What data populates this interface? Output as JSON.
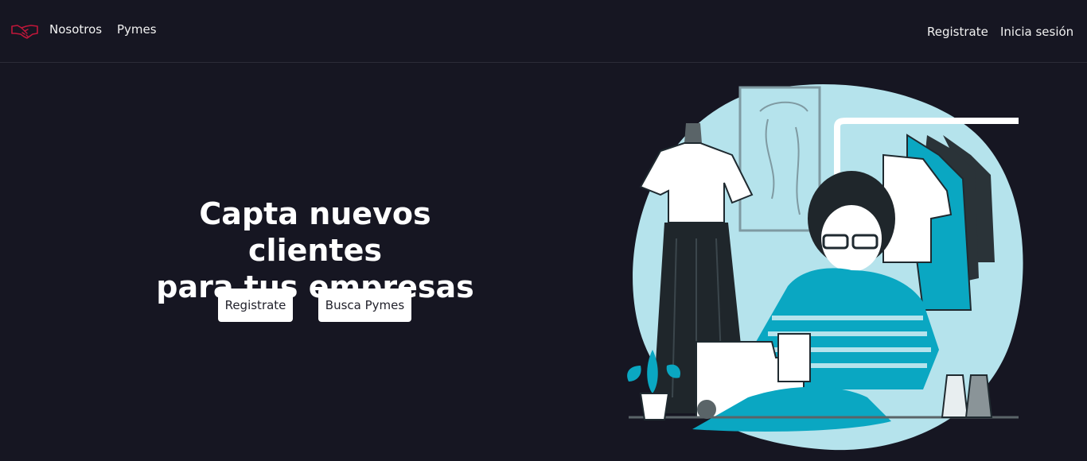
{
  "nav": {
    "logo_icon": "handshake-icon",
    "links": [
      "Nosotros",
      "Pymes"
    ],
    "right_links": [
      "Registrate",
      "Inicia sesión"
    ]
  },
  "hero": {
    "title_line1": "Capta nuevos clientes",
    "title_line2": "para tus empresas",
    "buttons": [
      "Registrate",
      "Busca Pymes"
    ],
    "illustration": "tailor-sewing-illustration"
  },
  "colors": {
    "background": "#161622",
    "accent_teal": "#0aa7c2",
    "blob_light": "#b5e3ec",
    "logo_red": "#c0173a"
  }
}
